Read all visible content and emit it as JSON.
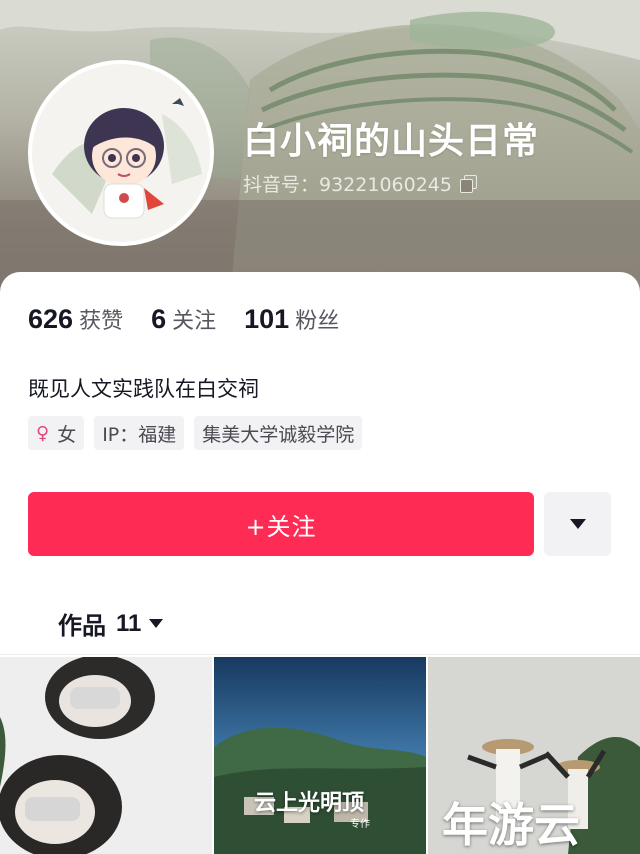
{
  "profile": {
    "nickname": "白小祠的山头日常",
    "douyin_id": "抖音号：93221060245",
    "bio": "既见人文实践队在白交祠"
  },
  "stats": [
    {
      "value": "626",
      "label": "获赞"
    },
    {
      "value": "6",
      "label": "关注"
    },
    {
      "value": "101",
      "label": "粉丝"
    }
  ],
  "tags": {
    "gender": "女",
    "ip": "IP：福建",
    "school": "集美大学诚毅学院"
  },
  "actions": {
    "follow_label": "+关注",
    "more_icon": "triangle-down-icon"
  },
  "works_tab": {
    "label": "作品",
    "count": "11"
  },
  "thumbnails": [
    {
      "text": ""
    },
    {
      "text": "云上光明顶",
      "sub": "专作"
    },
    {
      "text": "年游云"
    }
  ],
  "colors": {
    "accent": "#fe2c55",
    "text_primary": "#161823",
    "tag_bg": "#f2f2f4",
    "female": "#e0477a"
  }
}
